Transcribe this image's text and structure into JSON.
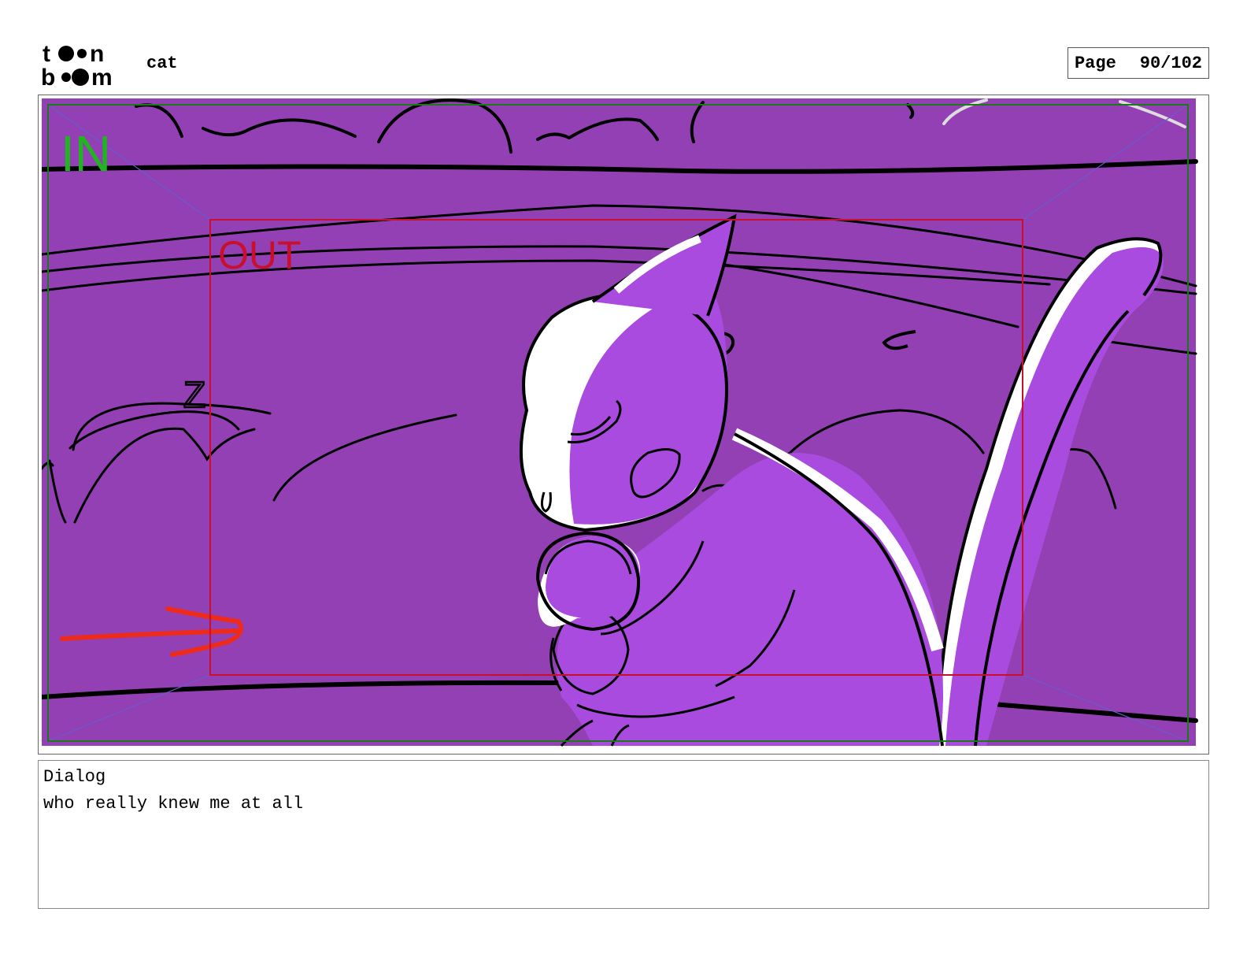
{
  "header": {
    "project_name": "cat",
    "page_label": "Page",
    "page_counter": "90/102"
  },
  "panel": {
    "in_label": "IN",
    "out_label": "OUT",
    "z_label": "Z"
  },
  "dialog": {
    "label": "Dialog",
    "text": "who really knew me at all"
  },
  "colors": {
    "background_purple": "#9340b5",
    "cat_purple": "#a94bdf",
    "in_frame_green": "#1a7a1a",
    "out_frame_red": "#c8102e",
    "in_label_green": "#1fb51f",
    "arrow_red": "#ee2a1a",
    "camera_guide_blue": "#6a5acd"
  }
}
